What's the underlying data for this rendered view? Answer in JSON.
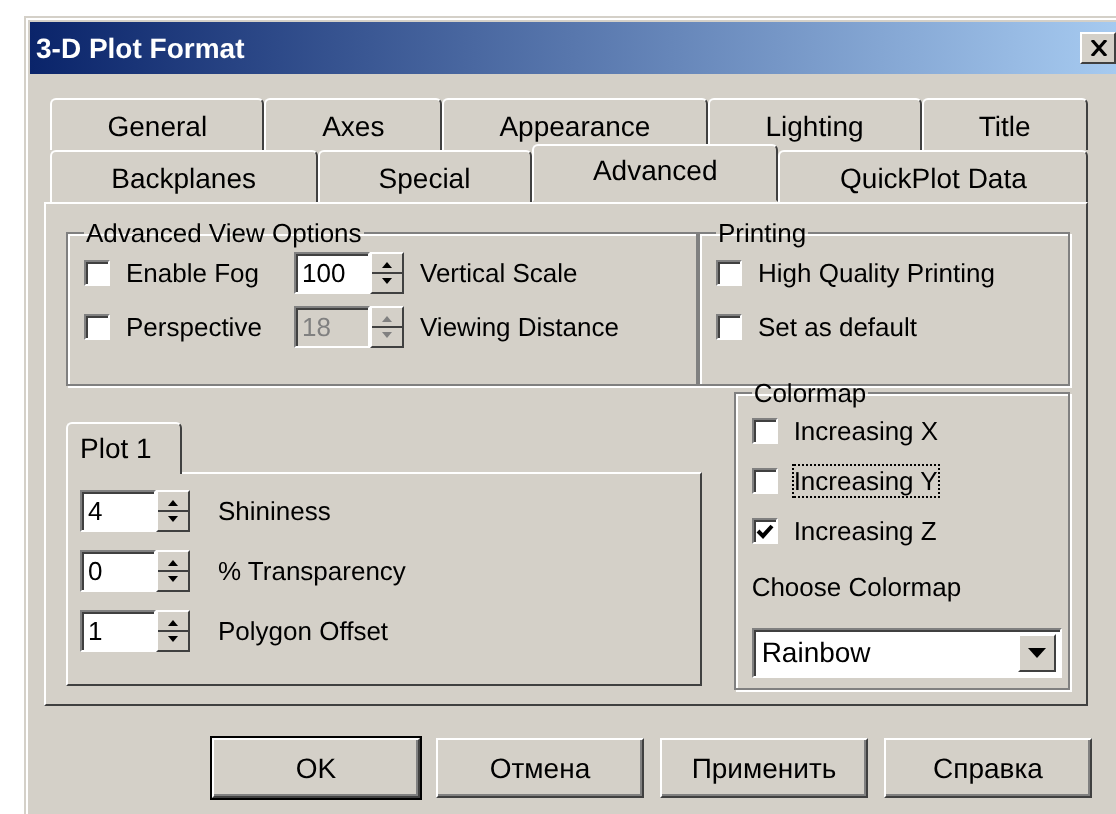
{
  "window": {
    "title": "3-D Plot Format"
  },
  "tab_rows": [
    [
      {
        "label": "General",
        "selected": false
      },
      {
        "label": "Axes",
        "selected": false
      },
      {
        "label": "Appearance",
        "selected": false
      },
      {
        "label": "Lighting",
        "selected": false
      },
      {
        "label": "Title",
        "selected": false
      }
    ],
    [
      {
        "label": "Backplanes",
        "selected": false
      },
      {
        "label": "Special",
        "selected": false
      },
      {
        "label": "Advanced",
        "selected": true
      },
      {
        "label": "QuickPlot Data",
        "selected": false
      }
    ]
  ],
  "advanced_view_options": {
    "title": "Advanced View Options",
    "rows": [
      {
        "checkbox": {
          "label": "Enable Fog",
          "checked": false
        },
        "spinner": {
          "value": "100",
          "disabled": false
        },
        "caption": {
          "label": "Vertical Scale"
        }
      },
      {
        "checkbox": {
          "label": "Perspective",
          "checked": false
        },
        "spinner": {
          "value": "18",
          "disabled": true
        },
        "caption": {
          "label": "Viewing Distance"
        }
      }
    ]
  },
  "printing": {
    "title": "Printing",
    "options": [
      {
        "label": "High Quality Printing",
        "checked": false
      },
      {
        "label": "Set as default",
        "checked": false
      }
    ]
  },
  "plot_tabs": [
    {
      "label": "Plot 1",
      "selected": true
    }
  ],
  "plot_settings": [
    {
      "value": "4",
      "label": "Shininess"
    },
    {
      "value": "0",
      "label": "% Transparency"
    },
    {
      "value": "1",
      "label": "Polygon Offset"
    }
  ],
  "colormap": {
    "title": "Colormap",
    "options": [
      {
        "label": "Increasing X",
        "checked": false,
        "focused": false
      },
      {
        "label": "Increasing Y",
        "checked": false,
        "focused": true
      },
      {
        "label": "Increasing Z",
        "checked": true,
        "focused": false
      }
    ],
    "choose_label": {
      "label": "Choose Colormap"
    },
    "dropdown": {
      "value": "Rainbow"
    }
  },
  "buttons": [
    {
      "label": "OK",
      "default": true
    },
    {
      "label": "Отмена",
      "default": false
    },
    {
      "label": "Применить",
      "default": false
    },
    {
      "label": "Справка",
      "default": false
    }
  ]
}
